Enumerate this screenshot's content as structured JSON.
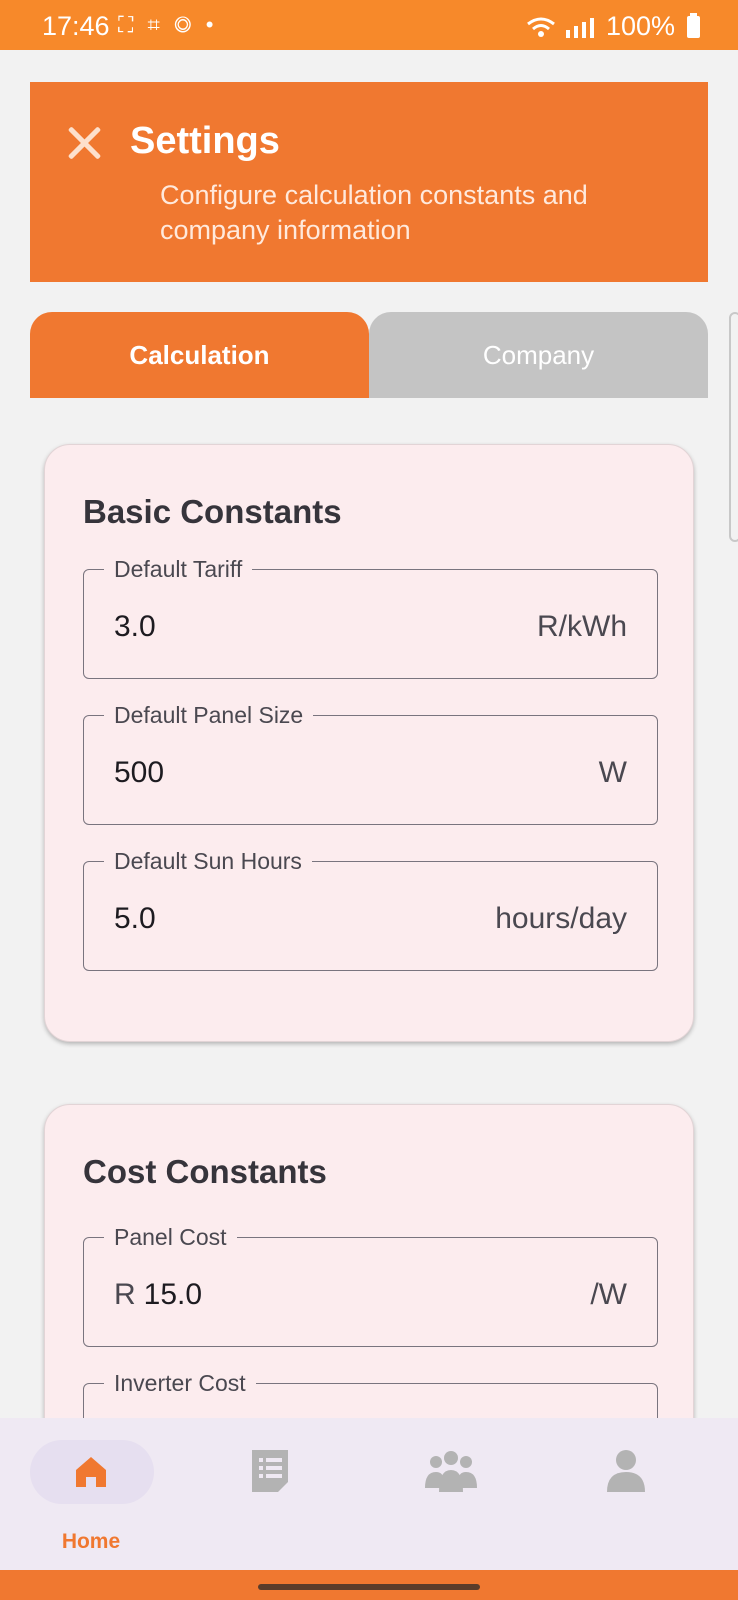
{
  "status_bar": {
    "time": "17:46",
    "left_icons": "⛶ ⌗ ◎ •",
    "battery": "100%"
  },
  "header": {
    "title": "Settings",
    "subtitle": "Configure calculation constants and company information"
  },
  "tabs": [
    {
      "label": "Calculation",
      "active": true
    },
    {
      "label": "Company",
      "active": false
    }
  ],
  "basic_constants": {
    "title": "Basic Constants",
    "fields": [
      {
        "label": "Default Tariff",
        "value": "3.0",
        "suffix": "R/kWh"
      },
      {
        "label": "Default Panel Size",
        "value": "500",
        "suffix": "W"
      },
      {
        "label": "Default Sun Hours",
        "value": "5.0",
        "suffix": "hours/day"
      }
    ]
  },
  "cost_constants": {
    "title": "Cost Constants",
    "fields": [
      {
        "label": "Panel Cost",
        "prefix": "R",
        "value": "15.0",
        "suffix": "/W"
      },
      {
        "label": "Inverter Cost",
        "value": "",
        "suffix": ""
      }
    ]
  },
  "bottom_nav": {
    "items": [
      {
        "label": "Home",
        "icon": "home-icon",
        "active": true
      },
      {
        "label": "",
        "icon": "document-icon",
        "active": false
      },
      {
        "label": "",
        "icon": "group-icon",
        "active": false
      },
      {
        "label": "",
        "icon": "person-icon",
        "active": false
      }
    ]
  },
  "colors": {
    "accent": "#f07830",
    "status_bar": "#f7892a",
    "card_bg": "#fcecee",
    "tab_inactive": "#c4c4c4",
    "nav_bg": "#efe9f3"
  }
}
